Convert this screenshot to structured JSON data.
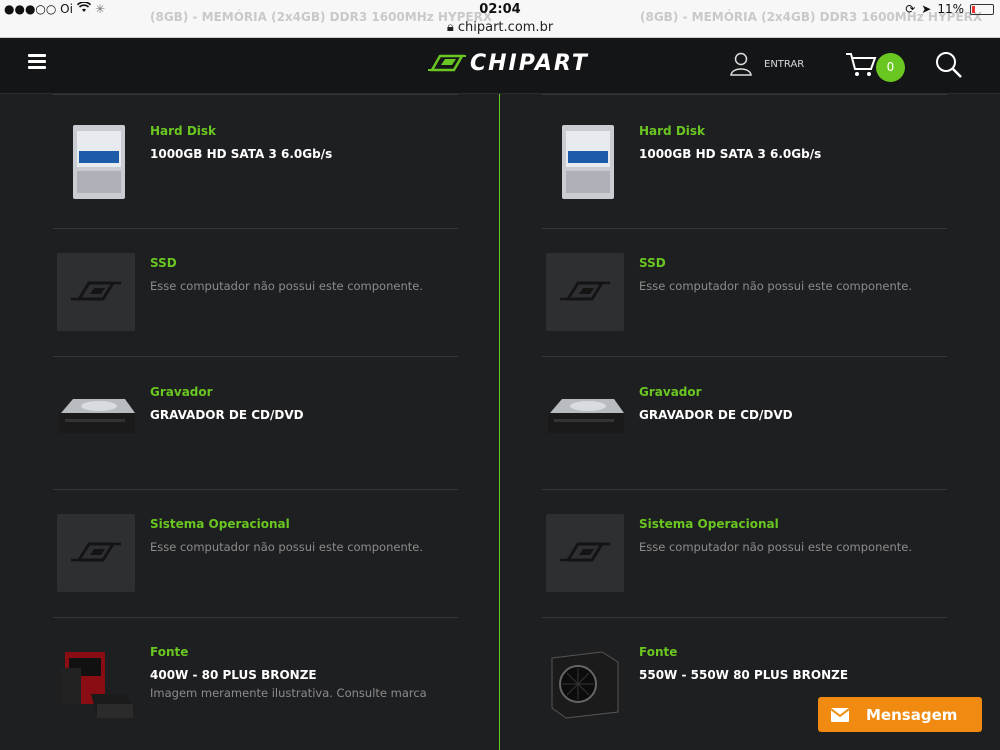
{
  "statusbar": {
    "carrier": "●●●○○ Oi",
    "time": "02:04",
    "url": "chipart.com.br",
    "battery": "11%",
    "ghost_left": "(8GB) - MEMÓRIA (2x4GB) DDR3 1600MHz HYPERX",
    "ghost_right": "(8GB) - MEMÓRIA (2x4GB) DDR3 1600MHz HYPERX"
  },
  "header": {
    "logo_text": "CHIPART",
    "login_label": "ENTRAR",
    "cart_count": "0"
  },
  "left_column": [
    {
      "label": "Hard Disk",
      "value": "1000GB HD SATA 3 6.0Gb/s",
      "note": "",
      "image": "hdd"
    },
    {
      "label": "SSD",
      "value": "",
      "note": "Esse computador não possui este componente.",
      "image": "placeholder"
    },
    {
      "label": "Gravador",
      "value": "GRAVADOR DE CD/DVD",
      "note": "",
      "image": "dvd"
    },
    {
      "label": "Sistema Operacional",
      "value": "",
      "note": "Esse computador não possui este componente.",
      "image": "placeholder"
    },
    {
      "label": "Fonte",
      "value": "400W - 80 PLUS BRONZE",
      "note": "Imagem meramente ilustrativa. Consulte marca",
      "image": "psu-box"
    }
  ],
  "right_column": [
    {
      "label": "Hard Disk",
      "value": "1000GB HD SATA 3 6.0Gb/s",
      "note": "",
      "image": "hdd"
    },
    {
      "label": "SSD",
      "value": "",
      "note": "Esse computador não possui este componente.",
      "image": "placeholder"
    },
    {
      "label": "Gravador",
      "value": "GRAVADOR DE CD/DVD",
      "note": "",
      "image": "dvd"
    },
    {
      "label": "Sistema Operacional",
      "value": "",
      "note": "Esse computador não possui este componente.",
      "image": "placeholder"
    },
    {
      "label": "Fonte",
      "value": "550W - 550W 80 PLUS BRONZE",
      "note": "",
      "image": "psu"
    }
  ],
  "message_button": {
    "label": "Mensagem"
  },
  "colors": {
    "accent": "#6ac621",
    "background": "#1e1f21",
    "header": "#141517",
    "message": "#f08a10"
  }
}
